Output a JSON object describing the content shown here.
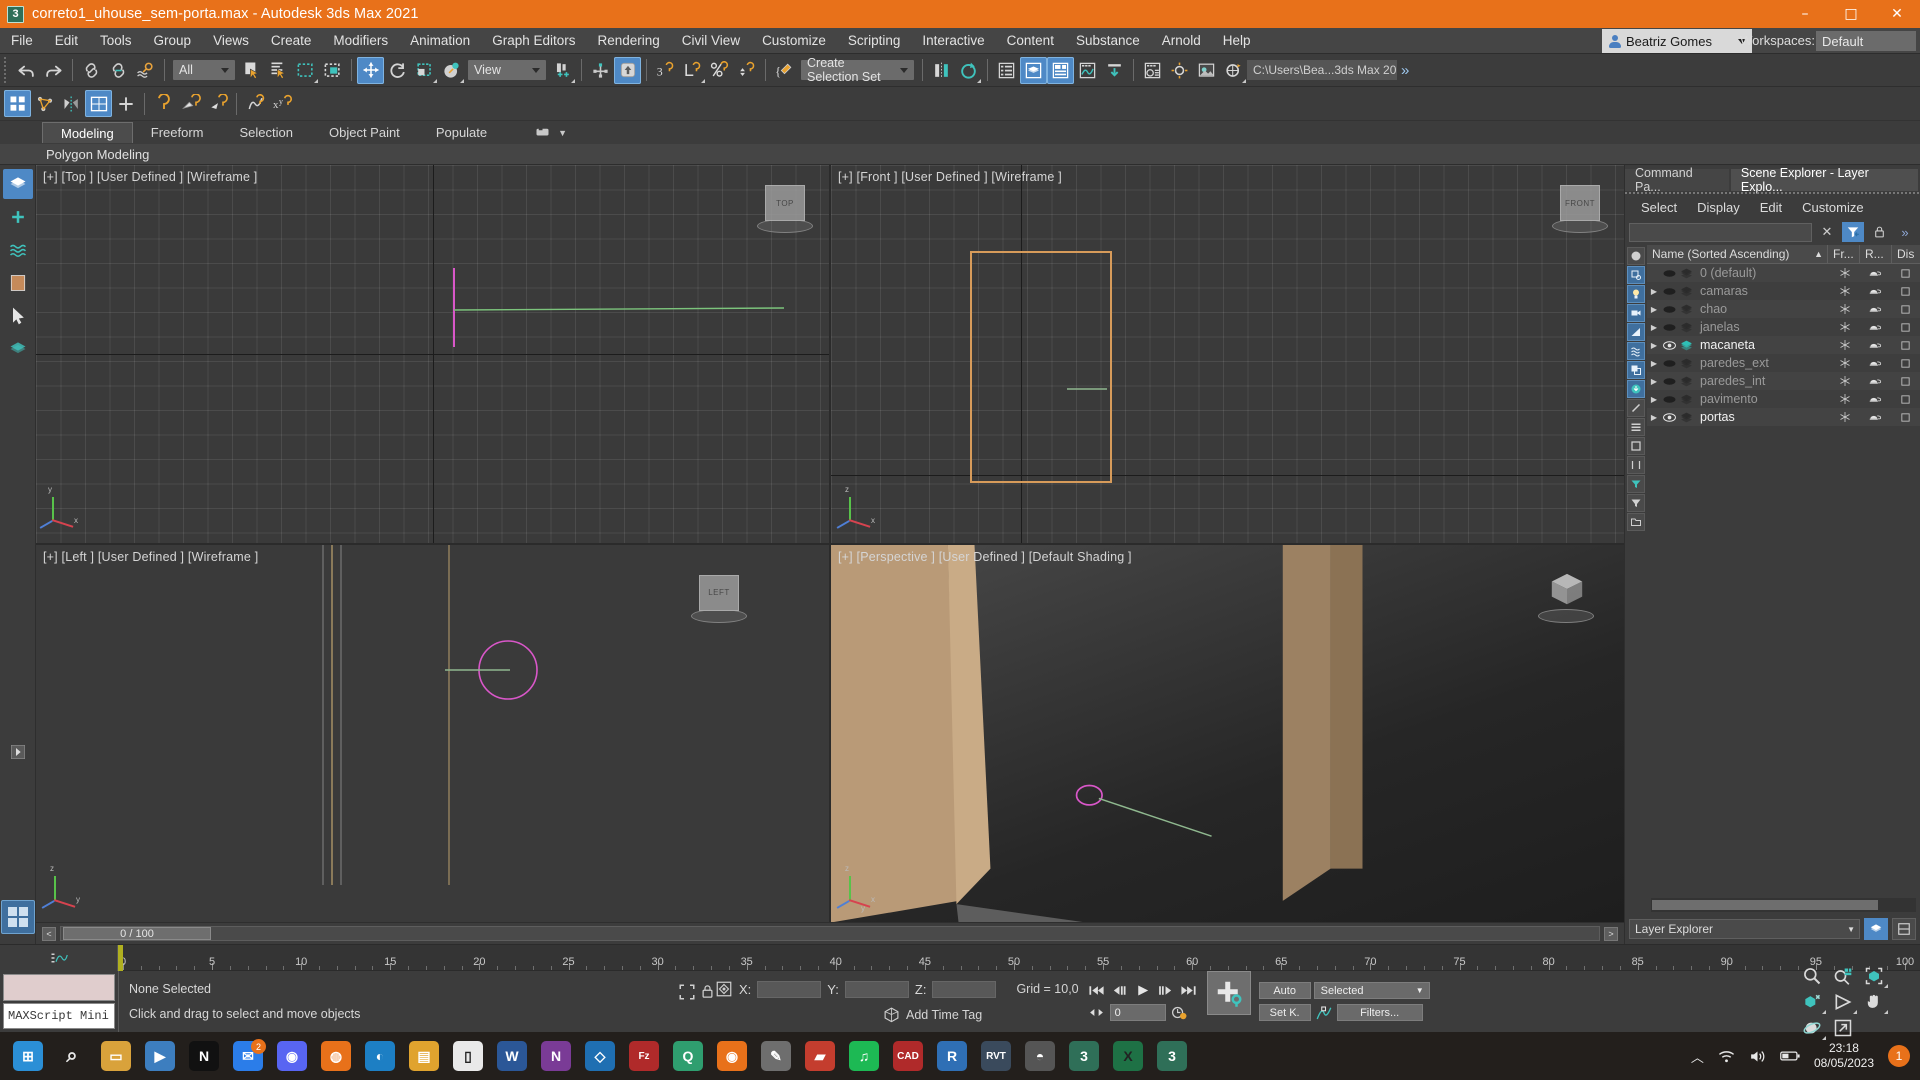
{
  "titlebar": {
    "title": "correto1_uhouse_sem-porta.max - Autodesk 3ds Max 2021",
    "app_icon": "3dsmax-icon",
    "minimize": "–",
    "maximize": "□",
    "close": "✕"
  },
  "menubar": {
    "items": [
      "File",
      "Edit",
      "Tools",
      "Group",
      "Views",
      "Create",
      "Modifiers",
      "Animation",
      "Graph Editors",
      "Rendering",
      "Civil View",
      "Customize",
      "Scripting",
      "Interactive",
      "Content",
      "Substance",
      "Arnold",
      "Help"
    ],
    "user_name": "Beatriz Gomes",
    "workspaces_label": "Workspaces:",
    "workspace_value": "Default"
  },
  "toolbar": {
    "selection_filter": "All",
    "reference_coord": "View",
    "selection_set": "Create Selection Set",
    "project_path": "C:\\Users\\Bea...3ds Max 202"
  },
  "ribbon": {
    "tabs": [
      "Modeling",
      "Freeform",
      "Selection",
      "Object Paint",
      "Populate"
    ],
    "selected_tab": "Modeling",
    "subtitle": "Polygon Modeling"
  },
  "viewports": [
    {
      "label": "[+] [Top ] [User Defined ] [Wireframe ]",
      "name": "viewport-top",
      "cube": "TOP",
      "active": false
    },
    {
      "label": "[+] [Front ] [User Defined ] [Wireframe ]",
      "name": "viewport-front",
      "cube": "FRONT",
      "active": false
    },
    {
      "label": "[+] [Left ] [User Defined ] [Wireframe ]",
      "name": "viewport-left",
      "cube": "LEFT",
      "active": false
    },
    {
      "label": "[+] [Perspective ] [User Defined ] [Default Shading ]",
      "name": "viewport-perspective",
      "cube": "",
      "active": true
    }
  ],
  "timeline": {
    "range_label": "0 / 100",
    "prev": "<",
    "next": ">"
  },
  "ruler": {
    "ticks": [
      0,
      5,
      10,
      15,
      20,
      25,
      30,
      35,
      40,
      45,
      50,
      55,
      60,
      65,
      70,
      75,
      80,
      85,
      90,
      95,
      100
    ]
  },
  "statusbar": {
    "maxscript_label": "MAXScript Mini",
    "selection_status": "None Selected",
    "prompt": "Click and drag to select and move objects",
    "x_label": "X:",
    "x_value": "",
    "y_label": "Y:",
    "y_value": "",
    "z_label": "Z:",
    "z_value": "",
    "grid": "Grid = 10,0",
    "add_time_tag": "Add Time Tag",
    "frame_value": "0",
    "auto_key": "Auto",
    "set_key": "Set K.",
    "key_filter": "Selected",
    "filters": "Filters..."
  },
  "explorer": {
    "tabs": [
      "Command Pa...",
      "Scene Explorer - Layer Explo..."
    ],
    "selected_tab": "Scene Explorer - Layer Explo...",
    "menu": [
      "Select",
      "Display",
      "Edit",
      "Customize"
    ],
    "search_value": "",
    "columns": [
      "Name (Sorted Ascending)",
      "Fr...",
      "R...",
      "Dis"
    ],
    "sort_arrow": "▲",
    "rows": [
      {
        "name": "0 (default)",
        "visible": false,
        "expandable": false,
        "highlighted": false
      },
      {
        "name": "camaras",
        "visible": false,
        "expandable": true,
        "highlighted": false
      },
      {
        "name": "chao",
        "visible": false,
        "expandable": true,
        "highlighted": false
      },
      {
        "name": "janelas",
        "visible": false,
        "expandable": true,
        "highlighted": false
      },
      {
        "name": "macaneta",
        "visible": true,
        "expandable": true,
        "highlighted": true
      },
      {
        "name": "paredes_ext",
        "visible": false,
        "expandable": true,
        "highlighted": false
      },
      {
        "name": "paredes_int",
        "visible": false,
        "expandable": true,
        "highlighted": false
      },
      {
        "name": "pavimento",
        "visible": false,
        "expandable": true,
        "highlighted": false
      },
      {
        "name": "portas",
        "visible": true,
        "expandable": true,
        "highlighted": true
      }
    ],
    "footer_select": "Layer Explorer"
  },
  "taskbar": {
    "items": [
      {
        "name": "start-windows",
        "color": "#2b8fd6",
        "glyph": "⊞"
      },
      {
        "name": "search",
        "color": "transparent",
        "glyph": "⌕"
      },
      {
        "name": "file-explorer",
        "color": "#d9a23b",
        "glyph": "▭"
      },
      {
        "name": "media-player",
        "color": "#3d7ebf",
        "glyph": "▶"
      },
      {
        "name": "netflix",
        "color": "#111111",
        "glyph": "N"
      },
      {
        "name": "messenger",
        "color": "#2b7de9",
        "glyph": "✉",
        "badge": "2"
      },
      {
        "name": "discord",
        "color": "#5865f2",
        "glyph": "◉"
      },
      {
        "name": "firefox",
        "color": "#e8711a",
        "glyph": "◍"
      },
      {
        "name": "edge",
        "color": "#1d7fc4",
        "glyph": "◐"
      },
      {
        "name": "folder",
        "color": "#e0a32e",
        "glyph": "▤"
      },
      {
        "name": "notepad",
        "color": "#e9e9e9",
        "glyph": "▯"
      },
      {
        "name": "word",
        "color": "#2b5797",
        "glyph": "W"
      },
      {
        "name": "onenote",
        "color": "#7a3b96",
        "glyph": "N"
      },
      {
        "name": "vscode",
        "color": "#1f6fb2",
        "glyph": "◇"
      },
      {
        "name": "filezilla",
        "color": "#b02a2a",
        "glyph": "Fz"
      },
      {
        "name": "qbittorrent",
        "color": "#2f9e6f",
        "glyph": "Q"
      },
      {
        "name": "chrome",
        "color": "#e8711a",
        "glyph": "◉"
      },
      {
        "name": "sketch-app",
        "color": "#6e6e6e",
        "glyph": "✎"
      },
      {
        "name": "adobe-app",
        "color": "#c43d2e",
        "glyph": "▰"
      },
      {
        "name": "spotify",
        "color": "#1db954",
        "glyph": "♫"
      },
      {
        "name": "autocad",
        "color": "#b02a2a",
        "glyph": "CAD"
      },
      {
        "name": "revit",
        "color": "#2f6fb5",
        "glyph": "R"
      },
      {
        "name": "revit-2",
        "color": "#3a4a5c",
        "glyph": "RVT"
      },
      {
        "name": "rhino",
        "color": "#555555",
        "glyph": "◓"
      },
      {
        "name": "3dsmax-a",
        "color": "#2f6f58",
        "glyph": "3"
      },
      {
        "name": "excel",
        "color": "#1e7145",
        "glyph": "X"
      },
      {
        "name": "3dsmax-active",
        "color": "#2f6f58",
        "glyph": "3"
      }
    ],
    "time": "23:18",
    "date": "08/05/2023",
    "notification_count": "1"
  }
}
